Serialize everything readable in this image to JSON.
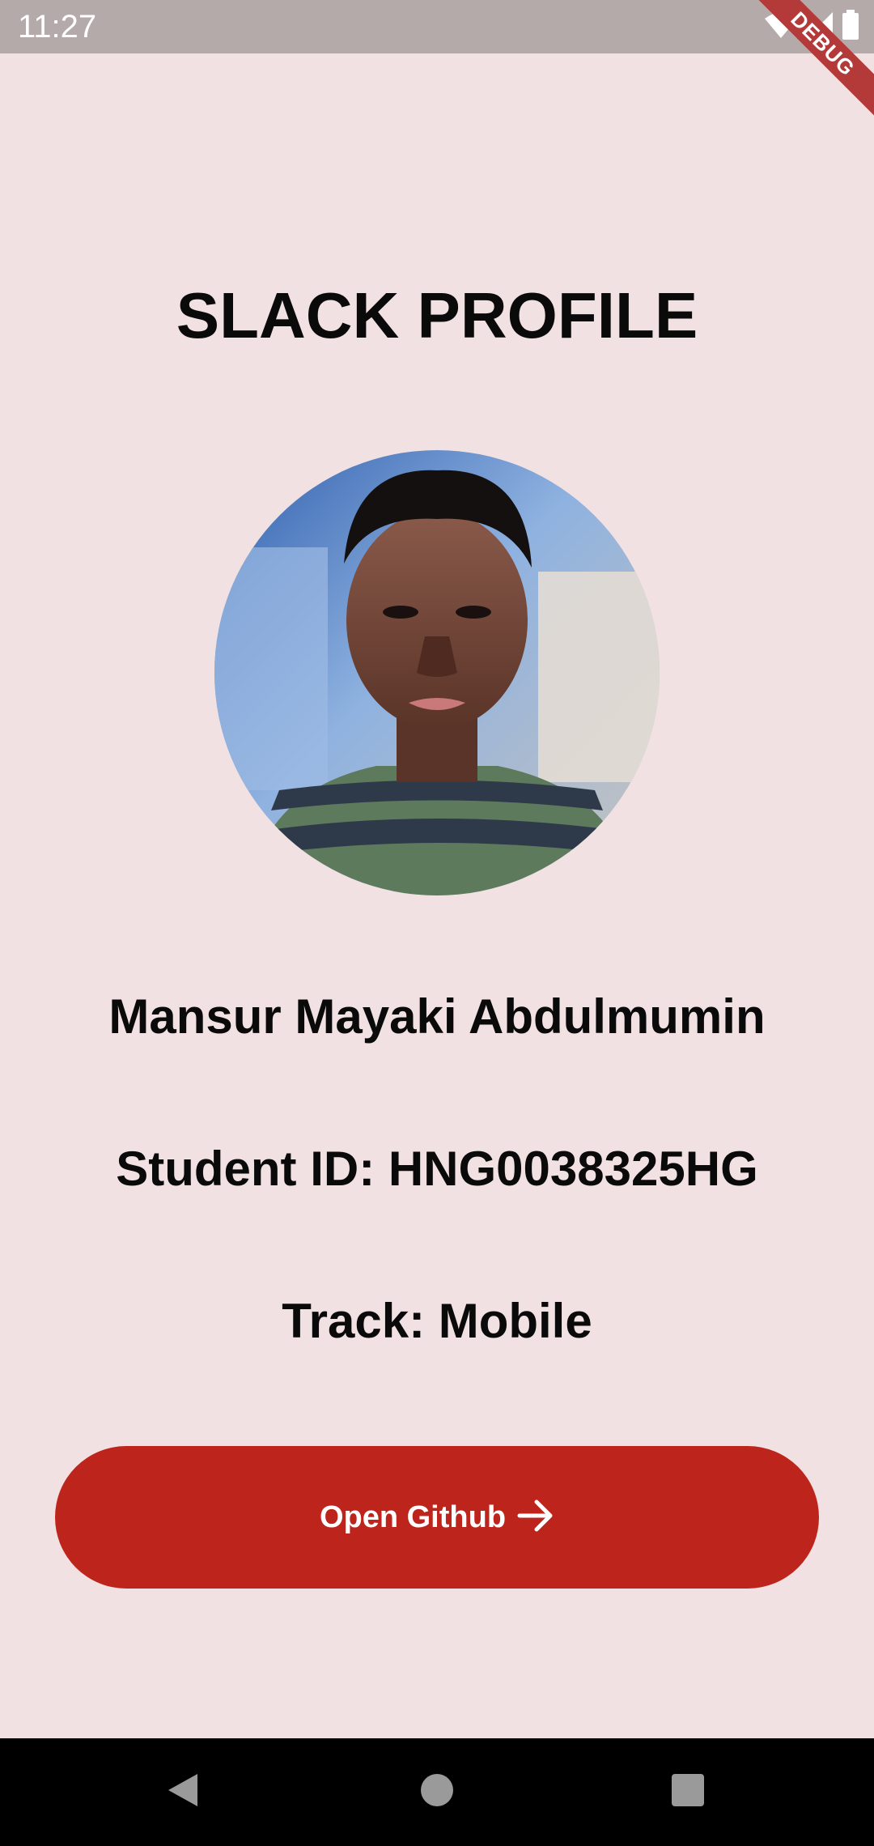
{
  "status_bar": {
    "time": "11:27",
    "icons": [
      "wifi-icon",
      "cell-signal-icon",
      "battery-icon"
    ]
  },
  "debug_banner": {
    "label": "DEBUG"
  },
  "page": {
    "title": "SLACK PROFILE",
    "name": "Mansur Mayaki Abdulmumin",
    "student_id": "Student ID: HNG0038325HG",
    "track": "Track: Mobile"
  },
  "button": {
    "label": "Open Github",
    "icon": "arrow-right-icon"
  },
  "nav_bar": {
    "icons": [
      "back-icon",
      "home-icon",
      "recents-icon"
    ]
  },
  "colors": {
    "background": "#f2e1e2",
    "status_bar": "#b5aaaa",
    "accent": "#bd241b",
    "debug_banner": "#b43a3a",
    "nav_bar": "#000000"
  }
}
